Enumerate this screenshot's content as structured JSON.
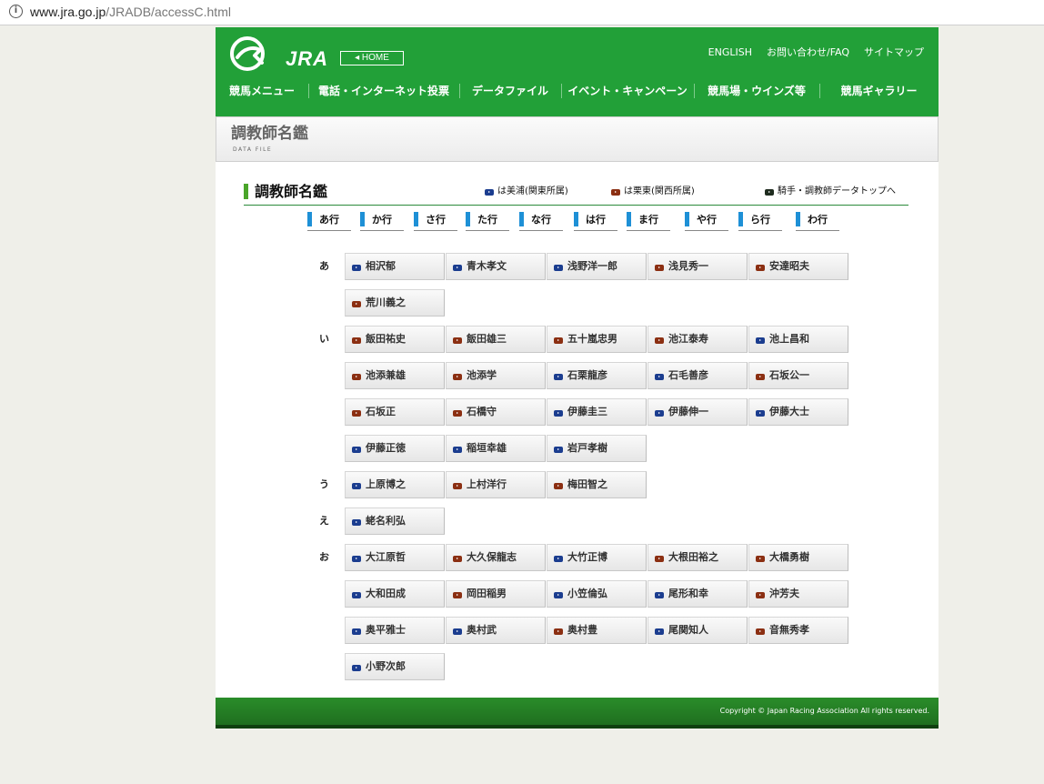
{
  "browser": {
    "url_host": "www.jra.go.jp",
    "url_path": "/JRADB/accessC.html"
  },
  "header": {
    "logo_text": "JRA",
    "home_label": "HOME",
    "top_links": [
      "ENGLISH",
      "お問い合わせ/FAQ",
      "サイトマップ"
    ],
    "nav": [
      "競馬メニュー",
      "電話・インターネット投票",
      "データファイル",
      "イベント・キャンペーン",
      "競馬場・ウインズ等",
      "競馬ギャラリー"
    ]
  },
  "data_file_bar": {
    "title": "調教師名鑑",
    "subtitle": "DATA FILE"
  },
  "section": {
    "title": "調教師名鑑",
    "legend_miho": "は美浦(関東所属)",
    "legend_ritto": "は栗東(関西所属)",
    "top_link": "騎手・調教師データトップへ"
  },
  "kana_tabs": [
    "あ行",
    "か行",
    "さ行",
    "た行",
    "な行",
    "は行",
    "ま行",
    "や行",
    "ら行",
    "わ行"
  ],
  "colors": {
    "header_green": "#22a038",
    "miho_blue": "#1b3d8f",
    "ritto_red": "#8b2f12",
    "tab_marker": "#1e90d6"
  },
  "groups": [
    {
      "kana": "あ",
      "rows": [
        [
          {
            "name": "相沢郁",
            "affil": "miho"
          },
          {
            "name": "青木孝文",
            "affil": "miho"
          },
          {
            "name": "浅野洋一郎",
            "affil": "miho"
          },
          {
            "name": "浅見秀一",
            "affil": "ritto"
          },
          {
            "name": "安達昭夫",
            "affil": "ritto"
          }
        ],
        [
          {
            "name": "荒川義之",
            "affil": "ritto"
          }
        ]
      ]
    },
    {
      "kana": "い",
      "rows": [
        [
          {
            "name": "飯田祐史",
            "affil": "ritto"
          },
          {
            "name": "飯田雄三",
            "affil": "ritto"
          },
          {
            "name": "五十嵐忠男",
            "affil": "ritto"
          },
          {
            "name": "池江泰寿",
            "affil": "ritto"
          },
          {
            "name": "池上昌和",
            "affil": "miho"
          }
        ],
        [
          {
            "name": "池添兼雄",
            "affil": "ritto"
          },
          {
            "name": "池添学",
            "affil": "ritto"
          },
          {
            "name": "石栗龍彦",
            "affil": "miho"
          },
          {
            "name": "石毛善彦",
            "affil": "miho"
          },
          {
            "name": "石坂公一",
            "affil": "ritto"
          }
        ],
        [
          {
            "name": "石坂正",
            "affil": "ritto"
          },
          {
            "name": "石橋守",
            "affil": "ritto"
          },
          {
            "name": "伊藤圭三",
            "affil": "miho"
          },
          {
            "name": "伊藤伸一",
            "affil": "miho"
          },
          {
            "name": "伊藤大士",
            "affil": "miho"
          }
        ],
        [
          {
            "name": "伊藤正徳",
            "affil": "miho"
          },
          {
            "name": "稲垣幸雄",
            "affil": "miho"
          },
          {
            "name": "岩戸孝樹",
            "affil": "miho"
          }
        ]
      ]
    },
    {
      "kana": "う",
      "rows": [
        [
          {
            "name": "上原博之",
            "affil": "miho"
          },
          {
            "name": "上村洋行",
            "affil": "ritto"
          },
          {
            "name": "梅田智之",
            "affil": "ritto"
          }
        ]
      ]
    },
    {
      "kana": "え",
      "rows": [
        [
          {
            "name": "蛯名利弘",
            "affil": "miho"
          }
        ]
      ]
    },
    {
      "kana": "お",
      "rows": [
        [
          {
            "name": "大江原哲",
            "affil": "miho"
          },
          {
            "name": "大久保龍志",
            "affil": "ritto"
          },
          {
            "name": "大竹正博",
            "affil": "miho"
          },
          {
            "name": "大根田裕之",
            "affil": "ritto"
          },
          {
            "name": "大橋勇樹",
            "affil": "ritto"
          }
        ],
        [
          {
            "name": "大和田成",
            "affil": "miho"
          },
          {
            "name": "岡田稲男",
            "affil": "ritto"
          },
          {
            "name": "小笠倫弘",
            "affil": "miho"
          },
          {
            "name": "尾形和幸",
            "affil": "miho"
          },
          {
            "name": "沖芳夫",
            "affil": "ritto"
          }
        ],
        [
          {
            "name": "奥平雅士",
            "affil": "miho"
          },
          {
            "name": "奥村武",
            "affil": "miho"
          },
          {
            "name": "奥村豊",
            "affil": "ritto"
          },
          {
            "name": "尾関知人",
            "affil": "miho"
          },
          {
            "name": "音無秀孝",
            "affil": "ritto"
          }
        ],
        [
          {
            "name": "小野次郎",
            "affil": "miho"
          }
        ]
      ]
    }
  ],
  "footer": {
    "copyright": "Copyright © Japan Racing Association All rights reserved."
  }
}
